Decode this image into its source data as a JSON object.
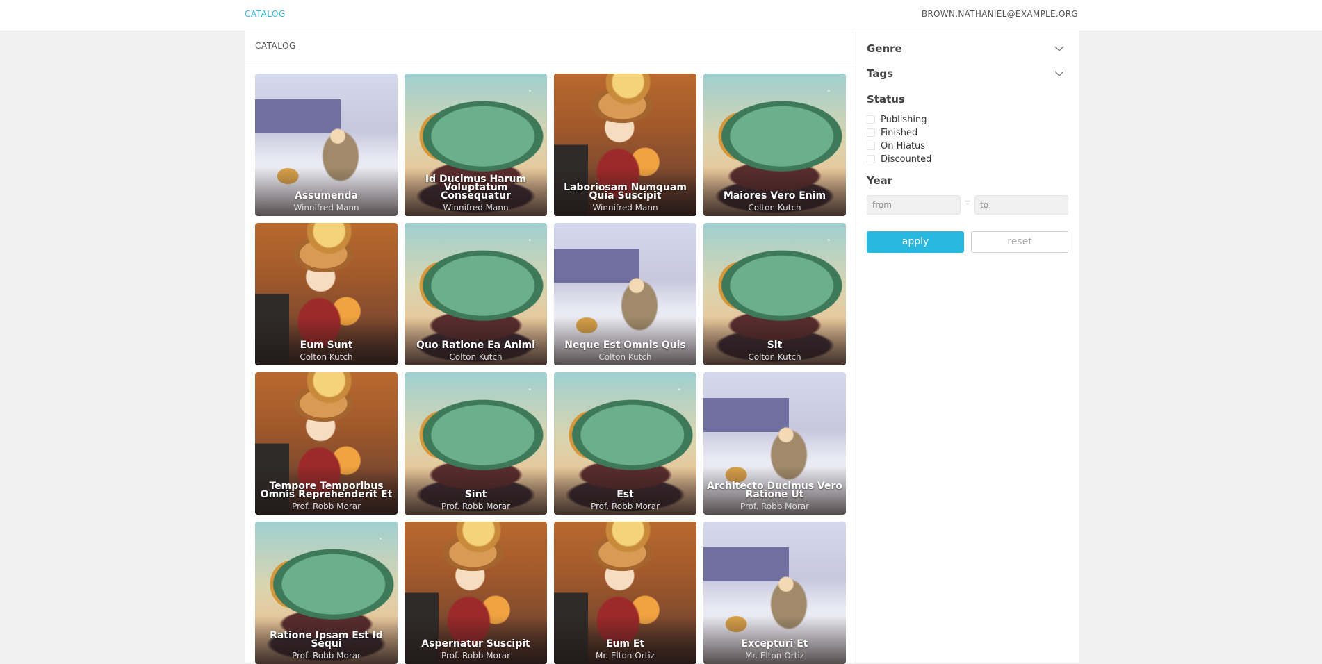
{
  "topbar": {
    "brand": "CATALOG",
    "user_email": "BROWN.NATHANIEL@EXAMPLE.ORG"
  },
  "main": {
    "header": "CATALOG",
    "cards": [
      {
        "title": "Assumenda",
        "author": "Winnifred Mann",
        "art": "winter"
      },
      {
        "title": "Id Ducimus Harum Voluptatum Consequatur",
        "author": "Winnifred Mann",
        "art": "tree"
      },
      {
        "title": "Laboriosam Numquam Quia Suscipit",
        "author": "Winnifred Mann",
        "art": "witch"
      },
      {
        "title": "Maiores Vero Enim",
        "author": "Colton Kutch",
        "art": "tree"
      },
      {
        "title": "Eum Sunt",
        "author": "Colton Kutch",
        "art": "witch"
      },
      {
        "title": "Quo Ratione Ea Animi",
        "author": "Colton Kutch",
        "art": "tree"
      },
      {
        "title": "Neque Est Omnis Quis",
        "author": "Colton Kutch",
        "art": "winter"
      },
      {
        "title": "Sit",
        "author": "Colton Kutch",
        "art": "tree"
      },
      {
        "title": "Tempore Temporibus Omnis Reprehenderit Et",
        "author": "Prof. Robb Morar",
        "art": "witch"
      },
      {
        "title": "Sint",
        "author": "Prof. Robb Morar",
        "art": "tree"
      },
      {
        "title": "Est",
        "author": "Prof. Robb Morar",
        "art": "tree"
      },
      {
        "title": "Architecto Ducimus Vero Ratione Ut",
        "author": "Prof. Robb Morar",
        "art": "winter"
      },
      {
        "title": "Ratione Ipsam Est Id Sequi",
        "author": "Prof. Robb Morar",
        "art": "tree"
      },
      {
        "title": "Aspernatur Suscipit",
        "author": "Prof. Robb Morar",
        "art": "witch"
      },
      {
        "title": "Eum Et",
        "author": "Mr. Elton Ortiz",
        "art": "witch"
      },
      {
        "title": "Excepturi Et",
        "author": "Mr. Elton Ortiz",
        "art": "winter"
      }
    ]
  },
  "sidebar": {
    "genre_label": "Genre",
    "tags_label": "Tags",
    "status_label": "Status",
    "status_options": [
      "Publishing",
      "Finished",
      "On Hiatus",
      "Discounted"
    ],
    "year_label": "Year",
    "year_from_placeholder": "from",
    "year_dash": "–",
    "year_to_placeholder": "to",
    "apply_label": "apply",
    "reset_label": "reset"
  },
  "colors": {
    "accent": "#29b8df",
    "page_background": "#f0f0f0"
  }
}
